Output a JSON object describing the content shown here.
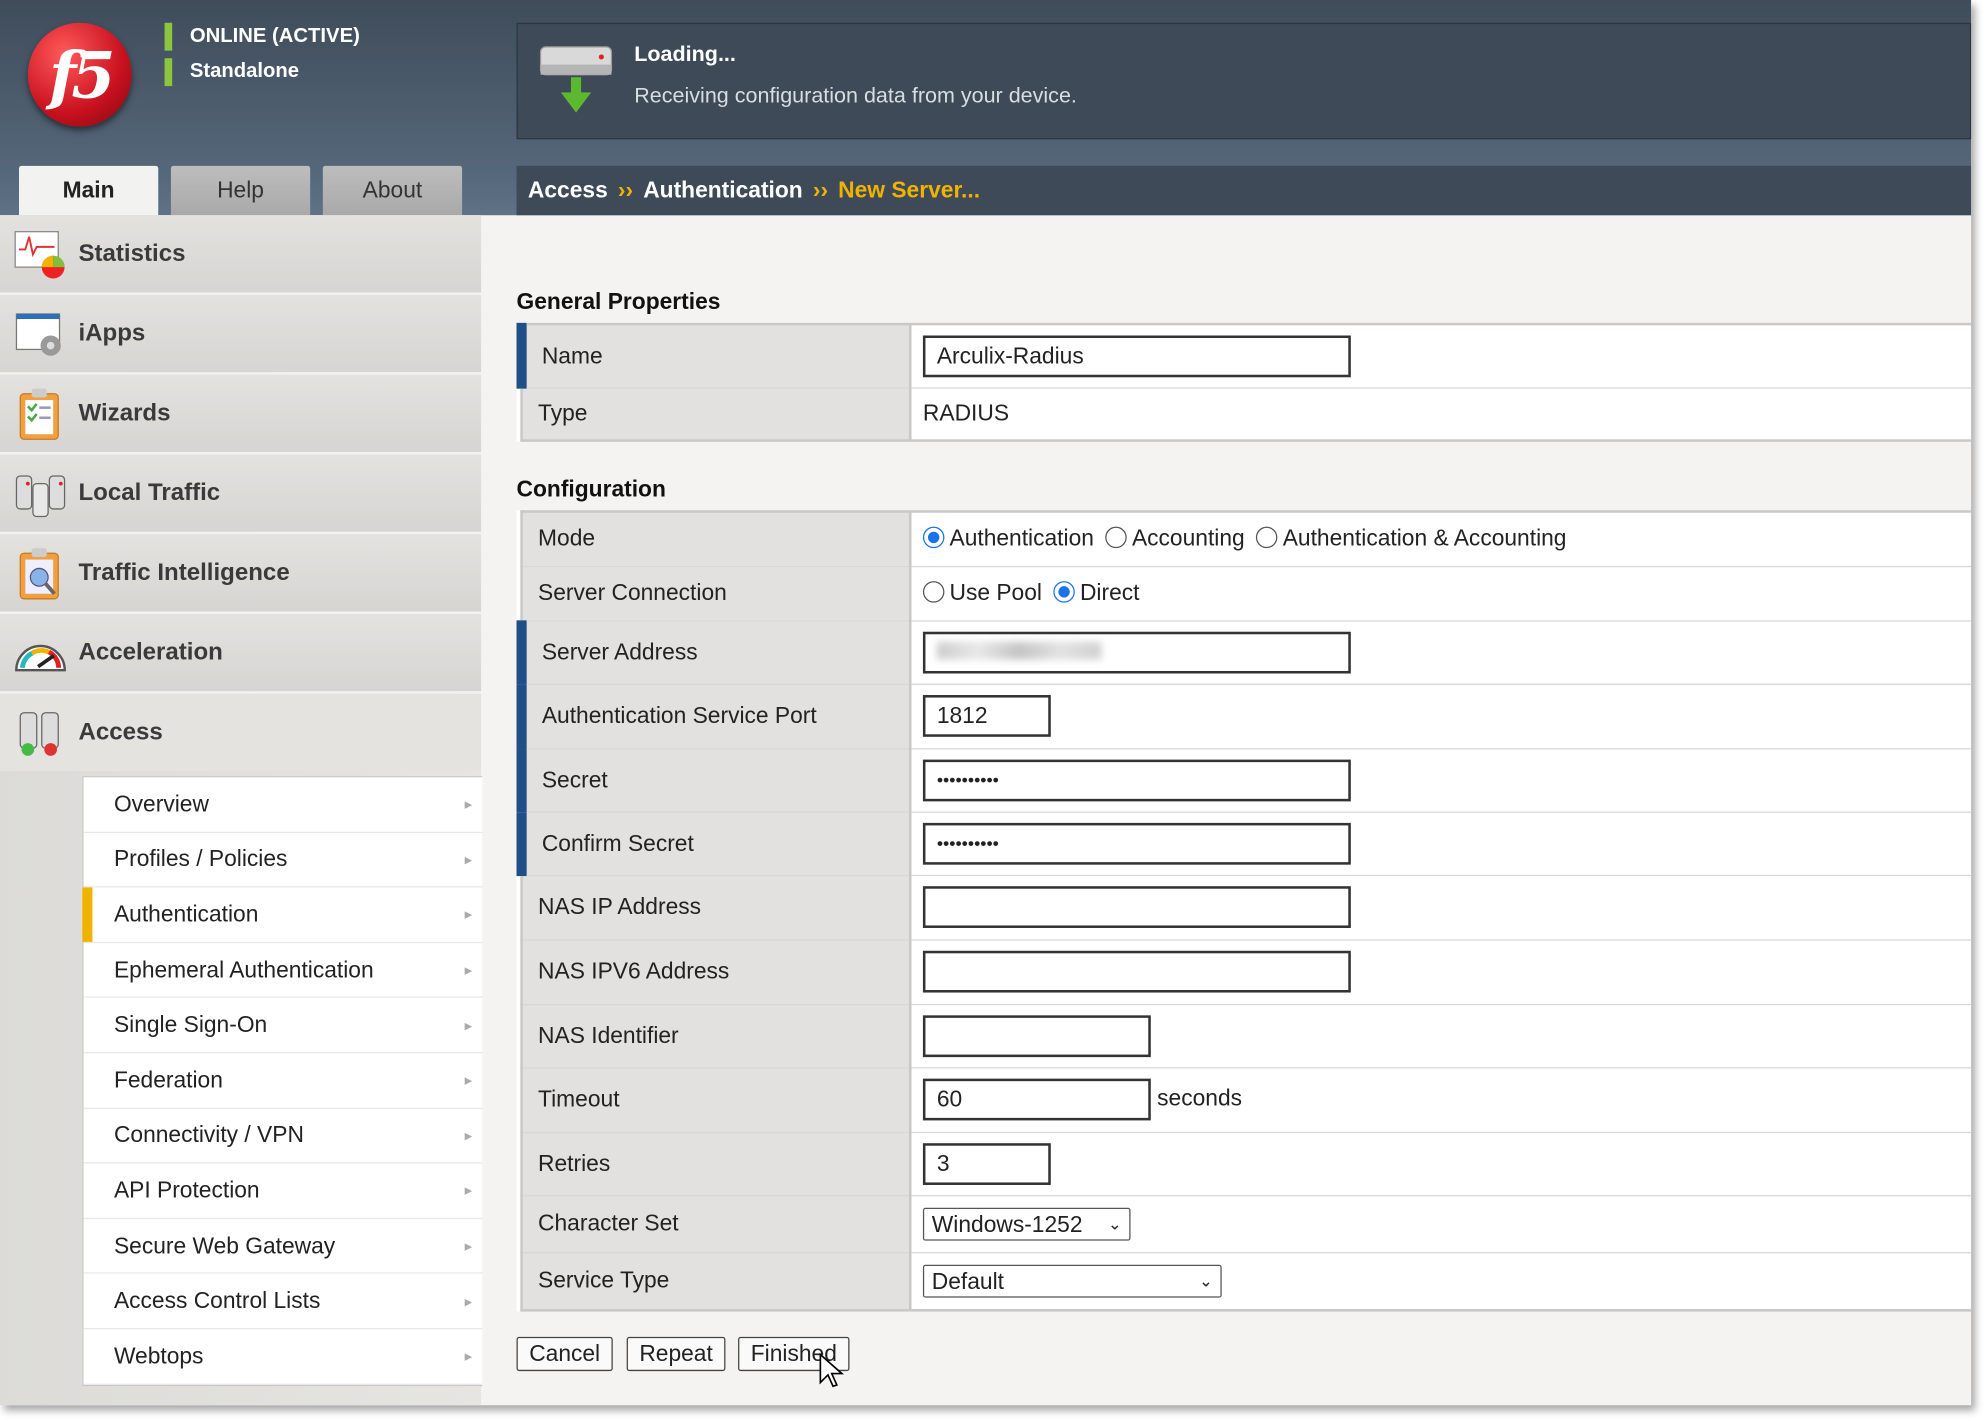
{
  "header": {
    "logo_text": "f5",
    "status_line1": "ONLINE (ACTIVE)",
    "status_line2": "Standalone",
    "loading_title": "Loading...",
    "loading_message": "Receiving configuration data from your device.",
    "status_color": "#8cc63f"
  },
  "tabs": [
    {
      "label": "Main",
      "active": true
    },
    {
      "label": "Help"
    },
    {
      "label": "About"
    }
  ],
  "breadcrumb": {
    "items": [
      "Access",
      "Authentication"
    ],
    "separator": "››",
    "current": "New Server..."
  },
  "sidebar": {
    "items": [
      {
        "label": "Statistics",
        "icon": "statistics-icon"
      },
      {
        "label": "iApps",
        "icon": "iapps-icon"
      },
      {
        "label": "Wizards",
        "icon": "wizards-icon"
      },
      {
        "label": "Local Traffic",
        "icon": "local-traffic-icon"
      },
      {
        "label": "Traffic Intelligence",
        "icon": "traffic-intelligence-icon"
      },
      {
        "label": "Acceleration",
        "icon": "acceleration-icon"
      },
      {
        "label": "Access",
        "icon": "access-icon"
      }
    ],
    "submenu": [
      "Overview",
      "Profiles / Policies",
      "Authentication",
      "Ephemeral Authentication",
      "Single Sign-On",
      "Federation",
      "Connectivity / VPN",
      "API Protection",
      "Secure Web Gateway",
      "Access Control Lists",
      "Webtops"
    ],
    "selected_submenu": "Authentication"
  },
  "general": {
    "heading": "General Properties",
    "name_label": "Name",
    "name_value": "Arculix-Radius",
    "type_label": "Type",
    "type_value": "RADIUS"
  },
  "config": {
    "heading": "Configuration",
    "mode_label": "Mode",
    "mode_options": [
      "Authentication",
      "Accounting",
      "Authentication & Accounting"
    ],
    "mode_selected": "Authentication",
    "conn_label": "Server Connection",
    "conn_options": [
      "Use Pool",
      "Direct"
    ],
    "conn_selected": "Direct",
    "server_address_label": "Server Address",
    "port_label": "Authentication Service Port",
    "port_value": "1812",
    "secret_label": "Secret",
    "secret_value": "••••••••••",
    "confirm_label": "Confirm Secret",
    "confirm_value": "••••••••••",
    "nas_ip_label": "NAS IP Address",
    "nas_ip_value": "",
    "nas_ipv6_label": "NAS IPV6 Address",
    "nas_ipv6_value": "",
    "nas_id_label": "NAS Identifier",
    "nas_id_value": "",
    "timeout_label": "Timeout",
    "timeout_value": "60",
    "timeout_unit": "seconds",
    "retries_label": "Retries",
    "retries_value": "3",
    "charset_label": "Character Set",
    "charset_value": "Windows-1252",
    "service_label": "Service Type",
    "service_value": "Default"
  },
  "buttons": {
    "cancel": "Cancel",
    "repeat": "Repeat",
    "finished": "Finished"
  }
}
